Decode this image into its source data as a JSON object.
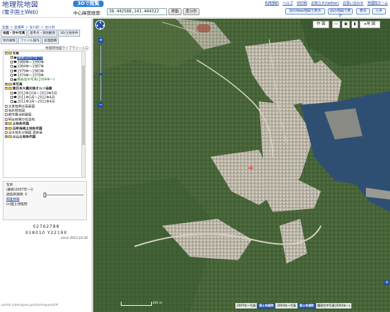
{
  "header": {
    "logo_line1": "地理院地図",
    "logo_line2": "(電子国土Web)",
    "btn_3d": "3Dで閲覧",
    "center_label": "中心緯度経度:",
    "center_value": "38.442588,141.444322",
    "move_btn": "移動",
    "deg_btn": "度分秒",
    "links": [
      "利用規約",
      "ヘルプ",
      "旧印刷",
      "お知らせ(twitter)",
      "お問い合わせ",
      "地理院ホーム"
    ],
    "btn_web_display": "別のWeb地図で表示",
    "btn_other_viewer": "別の地図で表示",
    "btn_show": "表示",
    "btn_enter": "入手"
  },
  "sidebar": {
    "breadcrumb": [
      "全国",
      "宮城県",
      "女川町",
      "女川浜"
    ],
    "tabs": [
      "地図・空中写真",
      "基準点・測地観測",
      "3D/土地条件",
      "地の解釈",
      "ファイル操作",
      "処理面積",
      "地名番号",
      "地理院地図Web"
    ],
    "tree_header": "地理院地図ライブラリー入口",
    "tree": [
      {
        "label": "写真",
        "level": 0,
        "kind": "folder",
        "expanded": true,
        "bold": true
      },
      {
        "label": "最新(2007年～)",
        "level": 1,
        "kind": "photo",
        "checked": true,
        "selected": true
      },
      {
        "label": "1988年～1990年",
        "level": 1,
        "kind": "photo"
      },
      {
        "label": "1984年～1987年",
        "level": 1,
        "kind": "photo"
      },
      {
        "label": "1979年～1983年",
        "level": 1,
        "kind": "photo"
      },
      {
        "label": "1974年～1978年",
        "level": 1,
        "kind": "photo"
      },
      {
        "label": "簡易空中写真(2004年～)",
        "level": 1,
        "kind": "photo",
        "checked": true,
        "green": true
      },
      {
        "label": "単写真",
        "level": 0,
        "kind": "folder",
        "bold": true
      },
      {
        "label": "東日本大震災後オルソ画像",
        "level": 0,
        "kind": "folder",
        "expanded": true,
        "bold": true
      },
      {
        "label": "2012年10月～2013年5月",
        "level": 1,
        "kind": "photo"
      },
      {
        "label": "2011年5月～2012年4月",
        "level": 1,
        "kind": "photo"
      },
      {
        "label": "2011年3月～2011年4月",
        "level": 1,
        "kind": "photo"
      },
      {
        "label": "災害復興計画基図",
        "level": 0,
        "kind": "check"
      },
      {
        "label": "色別標高図",
        "level": 0,
        "kind": "check"
      },
      {
        "label": "都市圏活断層図",
        "level": 0,
        "kind": "check"
      },
      {
        "label": "明治前期の低湿地",
        "level": 0,
        "kind": "check"
      },
      {
        "label": "土地条件図",
        "level": 0,
        "kind": "folder",
        "bold": true
      },
      {
        "label": "沿岸海域土地条件図",
        "level": 0,
        "kind": "folder",
        "bold": true
      },
      {
        "label": "治水地形分類図 更新版",
        "level": 0,
        "kind": "check"
      },
      {
        "label": "火山土地条件図",
        "level": 0,
        "kind": "folder",
        "bold": true
      }
    ],
    "info": {
      "title": "写真",
      "subtitle": "(最新(2007年～))",
      "opacity_label": "透過率調節:",
      "opacity_value": "0",
      "related_link": "関連情報",
      "copyright": "(c)国土地理院"
    },
    "coords_line1": "02762788",
    "coords_line2": "X18010 Y22190",
    "since": "since 2013.10.30",
    "status_url": "portal.cyberjapan.jp/site/mapuse4/#"
  },
  "map": {
    "tool_sakuzu": "作 図",
    "tool_chizu": "地 図",
    "scale_label": "300 m",
    "attribution": [
      "2007年～写真",
      "国土地理院",
      "2003年～写真",
      "国土地理院",
      "簡易空中写真(2004年～)"
    ],
    "colors": {
      "sea": "#2f4f72",
      "forest": "#3f5f32",
      "urban": "#b7b2a6",
      "accent": "#1f4fa8"
    }
  }
}
